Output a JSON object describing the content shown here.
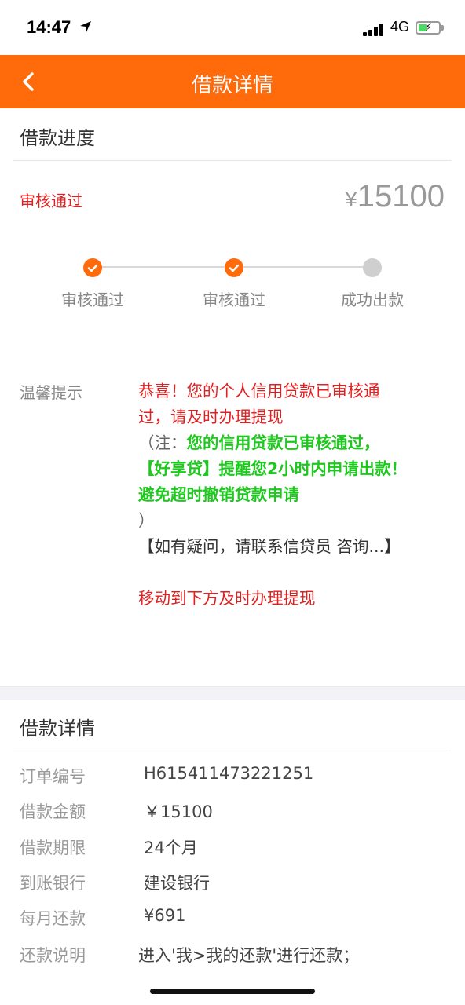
{
  "status_bar": {
    "time": "14:47",
    "network": "4G"
  },
  "header": {
    "title": "借款详情"
  },
  "progress_section": {
    "title": "借款进度",
    "status": "审核通过",
    "amount_symbol": "¥",
    "amount": "15100",
    "steps": [
      {
        "label": "审核通过",
        "done": true
      },
      {
        "label": "审核通过",
        "done": true
      },
      {
        "label": "成功出款",
        "done": false
      }
    ]
  },
  "tips": {
    "label": "温馨提示",
    "congrats_line1": "恭喜！您的个人信用贷款已审核通",
    "congrats_line2": "过，请及时办理提现",
    "note_open": "（注：",
    "note_line1": "您的信用贷款已审核通过，",
    "note_line2": "【好享贷】提醒您2小时内申请出款！",
    "note_line3": "避免超时撤销贷款申请",
    "note_close": "）",
    "contact": "【如有疑问，请联系信贷员 咨询...】",
    "move_hint": "移动到下方及时办理提现"
  },
  "details": {
    "title": "借款详情",
    "rows": [
      {
        "label": "订单编号",
        "value": "H615411473221251"
      },
      {
        "label": "借款金额",
        "value": "￥15100"
      },
      {
        "label": "借款期限",
        "value": "24个月"
      },
      {
        "label": "到账银行",
        "value": "建设银行"
      },
      {
        "label": "每月还款",
        "value": "¥691"
      },
      {
        "label": "还款说明",
        "value": "进入'我>我的还款'进行还款；"
      }
    ]
  },
  "colors": {
    "accent": "#ff6a0a",
    "alert": "#e02020",
    "highlight": "#1ec81e"
  }
}
